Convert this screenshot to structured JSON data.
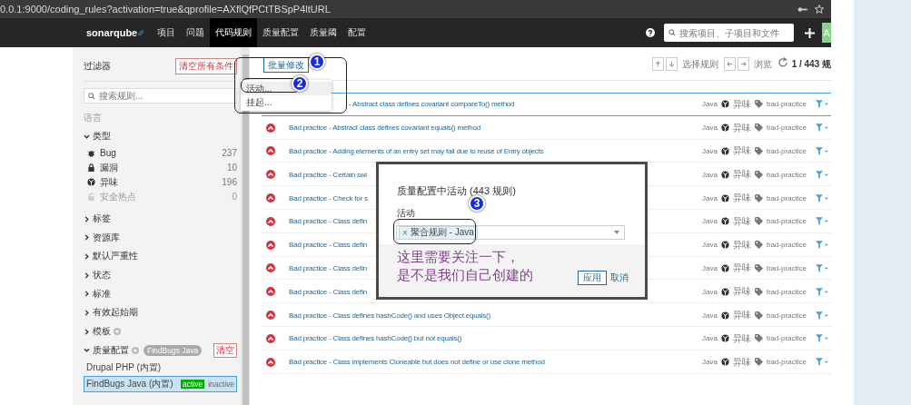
{
  "browser": {
    "url": "0.0.1:9000/coding_rules?activation=true&qprofile=AXflQfPCtTBSpP4ltURL"
  },
  "navbar": {
    "logo": "sonarqube",
    "items": [
      {
        "label": "项目",
        "selected": false
      },
      {
        "label": "问题",
        "selected": false
      },
      {
        "label": "代码规则",
        "selected": true
      },
      {
        "label": "质量配置",
        "selected": false
      },
      {
        "label": "质量阈",
        "selected": false
      },
      {
        "label": "配置",
        "selected": false
      }
    ],
    "search_placeholder": "搜索项目、子项目和文件",
    "avatar": "A"
  },
  "sidebar": {
    "title": "过滤器",
    "clear_all": "清空所有条件",
    "search_placeholder": "搜索规则...",
    "facets": [
      {
        "kind": "label",
        "label": "语言"
      },
      {
        "kind": "types",
        "label": "类型",
        "expanded": true,
        "items": [
          {
            "kind": "bug",
            "label": "Bug",
            "count": "237",
            "disabled": false
          },
          {
            "kind": "vulnerability",
            "label": "漏洞",
            "count": "10",
            "disabled": false
          },
          {
            "kind": "code_smell",
            "label": "异味",
            "count": "196",
            "disabled": false
          },
          {
            "kind": "hotspot",
            "label": "安全热点",
            "count": "0",
            "disabled": true
          }
        ]
      },
      {
        "kind": "facet",
        "label": "标签",
        "expanded": false,
        "help": false
      },
      {
        "kind": "facet",
        "label": "资源库",
        "expanded": false,
        "help": false
      },
      {
        "kind": "facet",
        "label": "默认严重性",
        "expanded": false,
        "help": false
      },
      {
        "kind": "facet",
        "label": "状态",
        "expanded": false,
        "help": false
      },
      {
        "kind": "facet",
        "label": "标准",
        "expanded": false,
        "help": false
      },
      {
        "kind": "facet",
        "label": "有效起始期",
        "expanded": false,
        "help": false
      },
      {
        "kind": "facet",
        "label": "模板",
        "expanded": false,
        "help": true
      },
      {
        "kind": "profiles",
        "label": "质量配置",
        "expanded": true,
        "help": true,
        "chip": "FindBugs Java",
        "clear": "清空",
        "profiles": [
          {
            "name": "Drupal PHP (内置)",
            "selected": false
          },
          {
            "name": "FindBugs Java (内置)",
            "selected": true,
            "states": [
              {
                "label": "active",
                "selected": true
              },
              {
                "label": "inactive",
                "selected": false
              }
            ]
          }
        ]
      }
    ]
  },
  "toolbar": {
    "bulk_change": "批量修改",
    "select_label": "选择规则",
    "browse_label": "浏览",
    "counter": "1 / 443 规"
  },
  "bulk_menu": {
    "items": [
      {
        "label": "活动...",
        "selected": true
      },
      {
        "label": "挂起...",
        "selected": false
      }
    ]
  },
  "rules": [
    {
      "title": "- Abstract class defines covariant compareTo() method",
      "selected": true,
      "language": "Java",
      "type": "异味",
      "tag": "bad-practice"
    },
    {
      "title": "Bad practice - Abstract class defines covariant equals() method",
      "selected": false,
      "language": "Java",
      "type": "异味",
      "tag": "bad-practice"
    },
    {
      "title": "Bad practice - Adding elements of an entry set may fail due to reuse of Entry objects",
      "selected": false,
      "language": "Java",
      "type": "异味",
      "tag": "bad-practice"
    },
    {
      "title": "Bad practice - Certain swi",
      "selected": false,
      "language": "Java",
      "type": "异味",
      "tag": "bad-practice"
    },
    {
      "title": "Bad practice - Check for s",
      "selected": false,
      "language": "Java",
      "type": "异味",
      "tag": "bad-practice"
    },
    {
      "title": "Bad practice - Class defin",
      "selected": false,
      "language": "Java",
      "type": "异味",
      "tag": "bad-practice"
    },
    {
      "title": "Bad practice - Class defin",
      "selected": false,
      "language": "Java",
      "type": "异味",
      "tag": "bad-practice"
    },
    {
      "title": "Bad practice - Class defin",
      "selected": false,
      "language": "Java",
      "type": "异味",
      "tag": "bad-practice"
    },
    {
      "title": "Bad practice - Class defin",
      "selected": false,
      "language": "Java",
      "type": "异味",
      "tag": "bad-practice"
    },
    {
      "title": "Bad practice - Class defines hashCode() and uses Object.equals()",
      "selected": false,
      "language": "Java",
      "type": "异味",
      "tag": "bad-practice"
    },
    {
      "title": "Bad practice - Class defines hashCode() but not equals()",
      "selected": false,
      "language": "Java",
      "type": "异味",
      "tag": "bad-practice"
    },
    {
      "title": "Bad practice - Class implements Cloneable but does not define or use clone method",
      "selected": false,
      "language": "Java",
      "type": "异味",
      "tag": "bad-practice"
    }
  ],
  "modal": {
    "title": "质量配置中活动 (443 规则)",
    "field_label": "活动",
    "chips": [
      {
        "remove": "×",
        "label": "聚合规则 - Java"
      }
    ],
    "apply": "应用",
    "cancel": "取消"
  },
  "annotations": {
    "badges": [
      "1",
      "2",
      "3"
    ],
    "note_lines": [
      "这里需要关注一下，",
      "是不是我们自己创建的"
    ]
  }
}
